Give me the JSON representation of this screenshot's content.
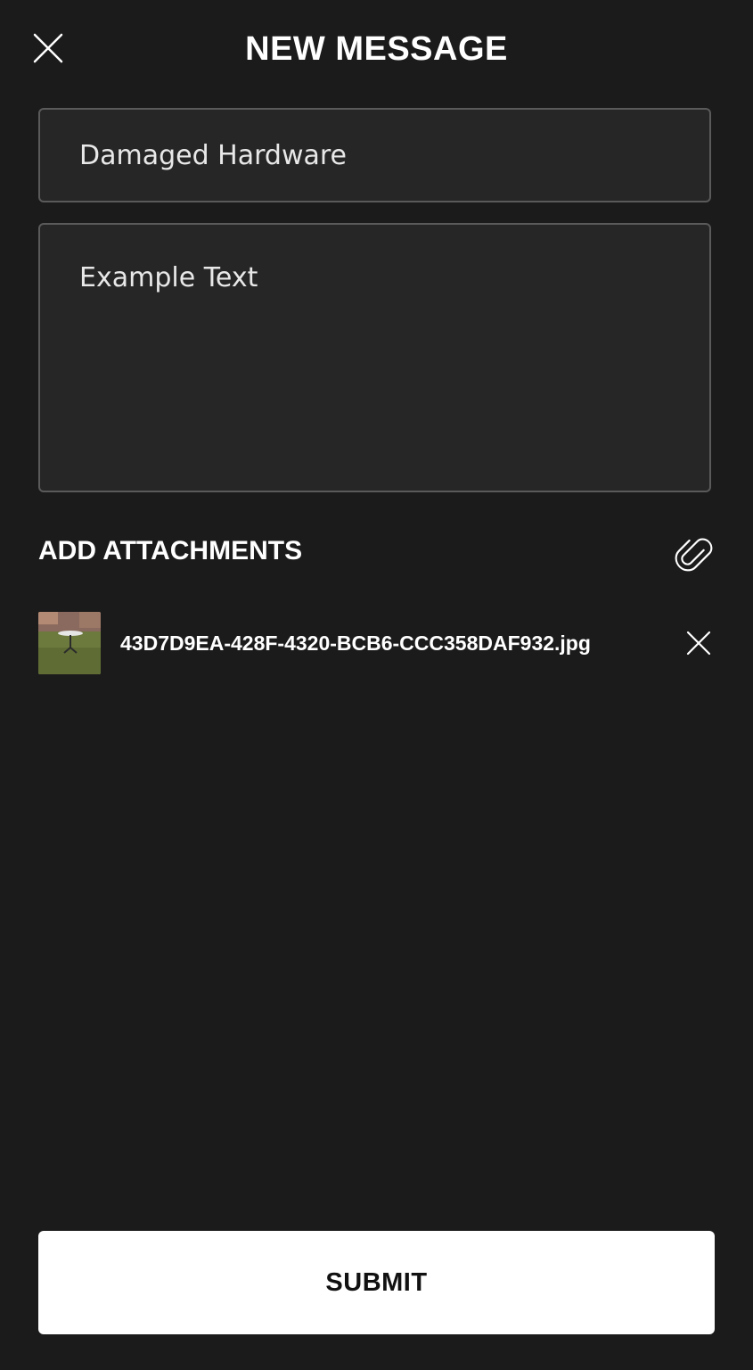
{
  "header": {
    "title": "NEW MESSAGE",
    "close_icon": "close-icon"
  },
  "form": {
    "subject_value": "Damaged Hardware",
    "body_value": "Example Text"
  },
  "attachments": {
    "section_label": "ADD ATTACHMENTS",
    "add_icon": "paperclip-icon",
    "items": [
      {
        "filename": "43D7D9EA-428F-4320-BCB6-CCC358DAF932.jpg",
        "thumbnail_icon": "image-thumbnail",
        "remove_icon": "close-icon"
      }
    ]
  },
  "footer": {
    "submit_label": "SUBMIT"
  },
  "colors": {
    "background": "#1b1b1b",
    "field_background": "#262626",
    "field_border": "#5a5a5a",
    "text": "#ffffff",
    "button_background": "#ffffff",
    "button_text": "#111111"
  }
}
